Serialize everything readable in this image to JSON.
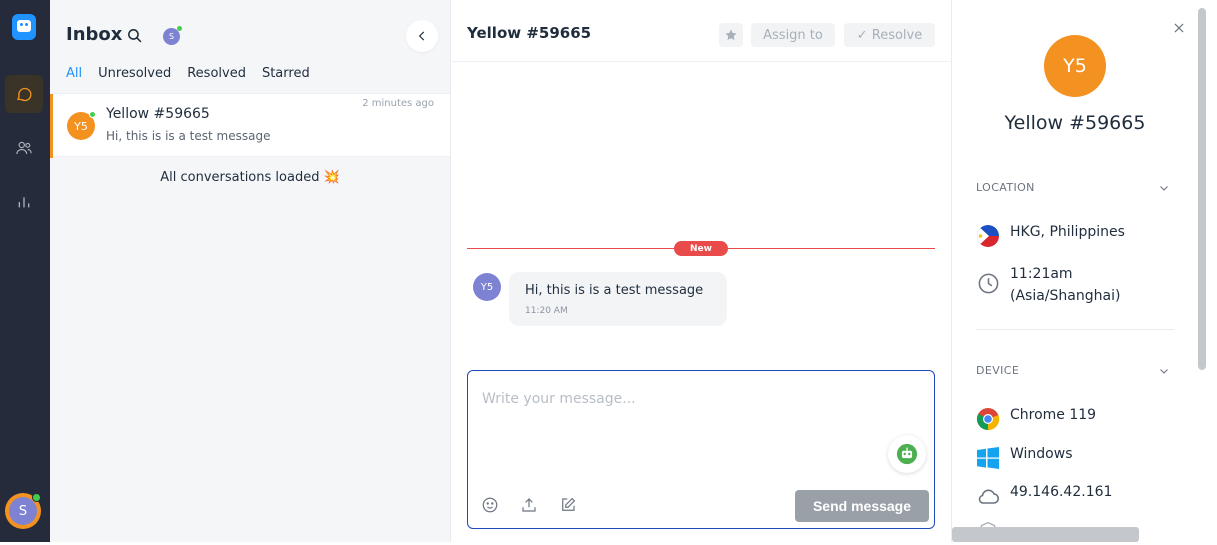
{
  "rail": {
    "user_initial": "S"
  },
  "list": {
    "title": "Inbox",
    "agent_initial": "S",
    "tabs": [
      {
        "label": "All",
        "active": true
      },
      {
        "label": "Unresolved",
        "active": false
      },
      {
        "label": "Resolved",
        "active": false
      },
      {
        "label": "Starred",
        "active": false
      }
    ],
    "conversation": {
      "initials": "Y5",
      "name": "Yellow #59665",
      "preview": "Hi, this is is a test message",
      "time": "2 minutes ago"
    },
    "loaded_text": "All conversations loaded 💥"
  },
  "chat": {
    "title": "Yellow #59665",
    "assign_label": "Assign to",
    "resolve_label": "✓ Resolve",
    "new_badge": "New",
    "message": {
      "initials": "Y5",
      "text": "Hi, this is is a test message",
      "time": "11:20 AM"
    },
    "composer_placeholder": "Write your message...",
    "send_label": "Send message"
  },
  "contact": {
    "initials": "Y5",
    "name": "Yellow #59665",
    "location_header": "LOCATION",
    "location": "HKG, Philippines",
    "local_time_line1": "11:21am",
    "local_time_line2": "(Asia/Shanghai)",
    "device_header": "DEVICE",
    "browser": "Chrome 119",
    "os": "Windows",
    "ip": "49.146.42.161"
  },
  "colors": {
    "accent": "#1f93ff",
    "avatar_orange": "#f39221",
    "avatar_purple": "#7d82d2",
    "online": "#44ce4b",
    "new_red": "#e94b4b",
    "rail_bg": "#262b3b"
  }
}
